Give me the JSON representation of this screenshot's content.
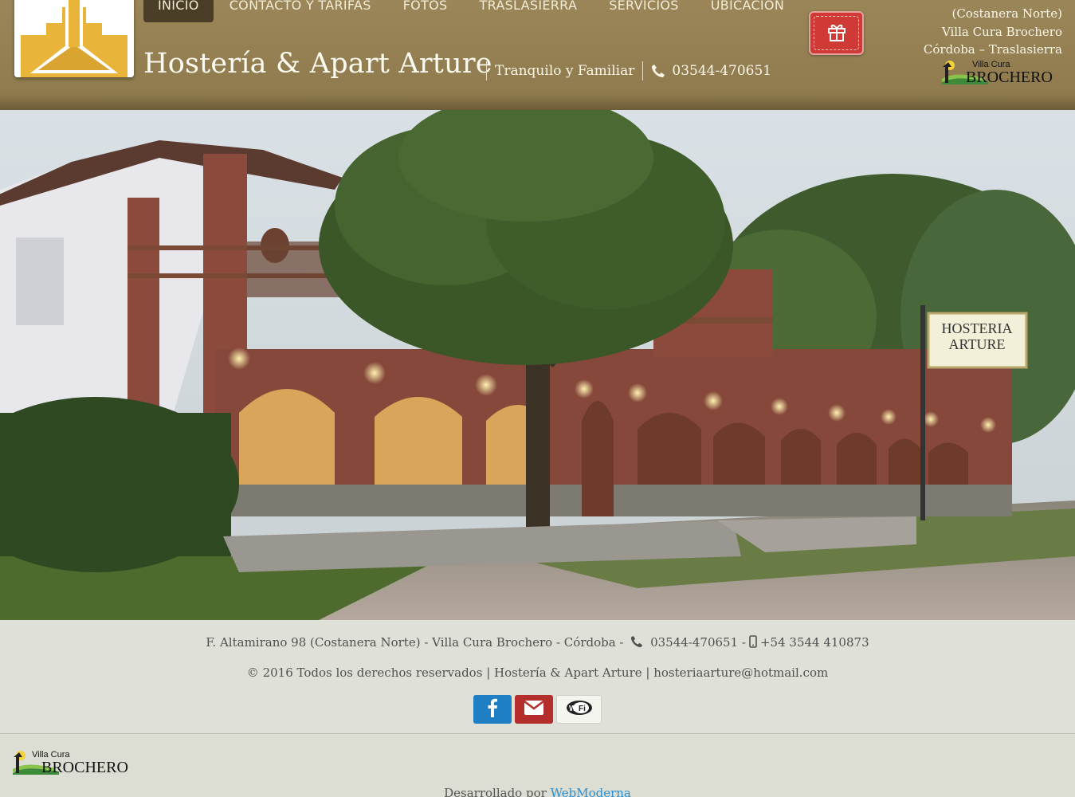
{
  "header": {
    "title": "Hostería & Apart Arture",
    "tagline": "Tranquilo y Familiar",
    "phone": "03544-470651",
    "nav": [
      {
        "label": "INICIO",
        "active": true
      },
      {
        "label": "CONTACTO Y TARIFAS",
        "active": false
      },
      {
        "label": "FOTOS",
        "active": false
      },
      {
        "label": "TRASLASIERRA",
        "active": false
      },
      {
        "label": "SERVICIOS",
        "active": false
      },
      {
        "label": "UBICACIÓN",
        "active": false
      }
    ],
    "address_lines": [
      "(Costanera Norte)",
      "Villa Cura Brochero",
      "Córdoba – Traslasierra"
    ],
    "partner_logo_small": "Villa Cura",
    "partner_logo_big": "BROCHERO",
    "gift_icon": "gift-icon",
    "colors": {
      "header_bg": "#8f7b4e",
      "nav_active": "#4b3e27",
      "gift": "#cf3a36"
    }
  },
  "hero": {
    "sign_line1": "HOSTERIA",
    "sign_line2": "ARTURE"
  },
  "footer": {
    "address": "F. Altamirano 98 (Costanera Norte) - Villa Cura Brochero - Córdoba -",
    "phone": "03544-470651",
    "phone_sep": "-",
    "mobile": "+54 3544 410873",
    "copyright": "© 2016 Todos los derechos reservados",
    "brand": "Hostería & Apart Arture",
    "email": "hosteriaarture@hotmail.com",
    "social": [
      {
        "name": "facebook",
        "icon": "facebook-icon",
        "color": "#1f7fc4"
      },
      {
        "name": "email",
        "icon": "envelope-icon",
        "color": "#b32e2c"
      },
      {
        "name": "wifi",
        "icon": "wifi-icon",
        "color": "#f5f5f0"
      }
    ],
    "partner_logo_small": "Villa Cura",
    "partner_logo_big": "BROCHERO",
    "dev_prefix": "Desarrollado por",
    "dev_name": "WebModerna"
  }
}
